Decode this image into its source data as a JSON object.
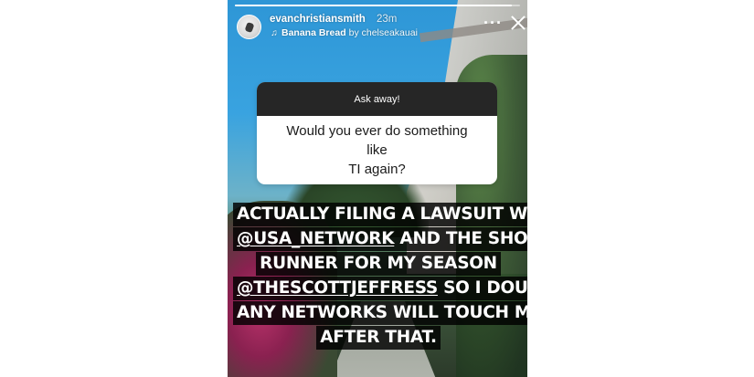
{
  "story": {
    "progress_fraction": 0.97,
    "header": {
      "username": "evanchristiansmith",
      "time": "23m",
      "music": {
        "icon": "music-note-icon",
        "song": "Banana Bread",
        "by_label": "by chelseakauai"
      },
      "more_icon": "more-horizontal-icon",
      "close_icon": "close-icon"
    },
    "question_sticker": {
      "prompt": "Ask away!",
      "question_line1": "Would you ever do something like",
      "question_line2": "TI again?"
    },
    "answer": {
      "line1": "ACTUALLY FILING A LAWSUIT WITH",
      "line2_mention": "@USA_NETWORK",
      "line2_rest": " AND THE SHOW",
      "line3": "RUNNER FOR MY SEASON",
      "line4_mention": "@THESCOTTJEFFRESS",
      "line4_rest": " SO I DOUBT",
      "line5": "ANY NETWORKS WILL TOUCH ME",
      "line6": "AFTER THAT."
    }
  },
  "colors": {
    "sticker_header": "#262626",
    "text_highlight": "#000000",
    "page_background": "#ffffff"
  }
}
